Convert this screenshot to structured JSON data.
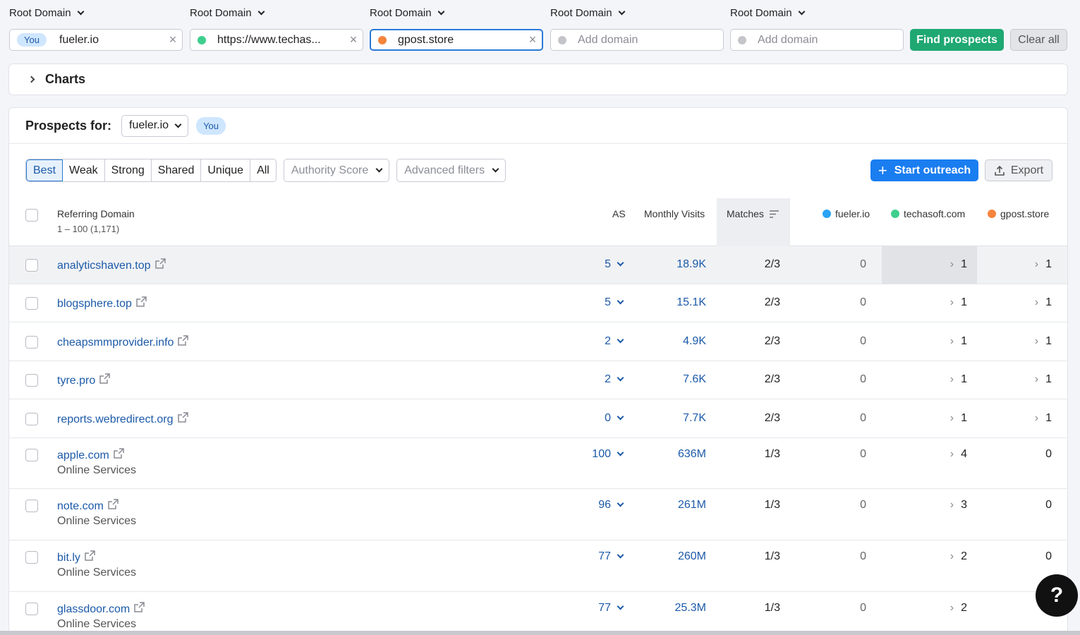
{
  "domain_bar": {
    "label": "Root Domain",
    "inputs": [
      {
        "badge": "You",
        "value": "fueler.io",
        "dot": "",
        "clear": "×"
      },
      {
        "value": "https://www.techas...",
        "dot": "#3ecf8e",
        "clear": "×"
      },
      {
        "value": "gpost.store",
        "dot": "#f5843c",
        "clear": "×"
      },
      {
        "placeholder": "Add domain",
        "dot": "#c4c5cb"
      },
      {
        "placeholder": "Add domain",
        "dot": "#c4c5cb"
      }
    ],
    "find_label": "Find prospects",
    "clear_label": "Clear all"
  },
  "charts": {
    "title": "Charts"
  },
  "prospects": {
    "label": "Prospects for:",
    "selected": "fueler.io",
    "you_badge": "You"
  },
  "filters": {
    "tabs": [
      "Best",
      "Weak",
      "Strong",
      "Shared",
      "Unique",
      "All"
    ],
    "active": "Best",
    "authority_score": "Authority Score",
    "advanced": "Advanced filters"
  },
  "actions": {
    "outreach": "Start outreach",
    "export": "Export"
  },
  "table": {
    "headers": {
      "domain": "Referring Domain",
      "range": "1 – 100 (1,171)",
      "as": "AS",
      "visits": "Monthly Visits",
      "matches": "Matches",
      "c1": "fueler.io",
      "c2": "techasoft.com",
      "c3": "gpost.store"
    },
    "legend_colors": {
      "c1": "#2aa3f5",
      "c2": "#3ecf8e",
      "c3": "#f5843c"
    },
    "rows": [
      {
        "domain": "analyticshaven.top",
        "category": "",
        "as": "5",
        "visits": "18.9K",
        "matches": "2/3",
        "c1": "0",
        "c2": "1",
        "c3": "1"
      },
      {
        "domain": "blogsphere.top",
        "category": "",
        "as": "5",
        "visits": "15.1K",
        "matches": "2/3",
        "c1": "0",
        "c2": "1",
        "c3": "1"
      },
      {
        "domain": "cheapsmmprovider.info",
        "category": "",
        "as": "2",
        "visits": "4.9K",
        "matches": "2/3",
        "c1": "0",
        "c2": "1",
        "c3": "1"
      },
      {
        "domain": "tyre.pro",
        "category": "",
        "as": "2",
        "visits": "7.6K",
        "matches": "2/3",
        "c1": "0",
        "c2": "1",
        "c3": "1"
      },
      {
        "domain": "reports.webredirect.org",
        "category": "",
        "as": "0",
        "visits": "7.7K",
        "matches": "2/3",
        "c1": "0",
        "c2": "1",
        "c3": "1"
      },
      {
        "domain": "apple.com",
        "category": "Online Services",
        "as": "100",
        "visits": "636M",
        "matches": "1/3",
        "c1": "0",
        "c2": "4",
        "c3": "0"
      },
      {
        "domain": "note.com",
        "category": "Online Services",
        "as": "96",
        "visits": "261M",
        "matches": "1/3",
        "c1": "0",
        "c2": "3",
        "c3": "0"
      },
      {
        "domain": "bit.ly",
        "category": "Online Services",
        "as": "77",
        "visits": "260M",
        "matches": "1/3",
        "c1": "0",
        "c2": "2",
        "c3": "0"
      },
      {
        "domain": "glassdoor.com",
        "category": "Online Services",
        "as": "77",
        "visits": "25.3M",
        "matches": "1/3",
        "c1": "0",
        "c2": "2",
        "c3": ""
      }
    ]
  },
  "help": {
    "label": "?"
  }
}
